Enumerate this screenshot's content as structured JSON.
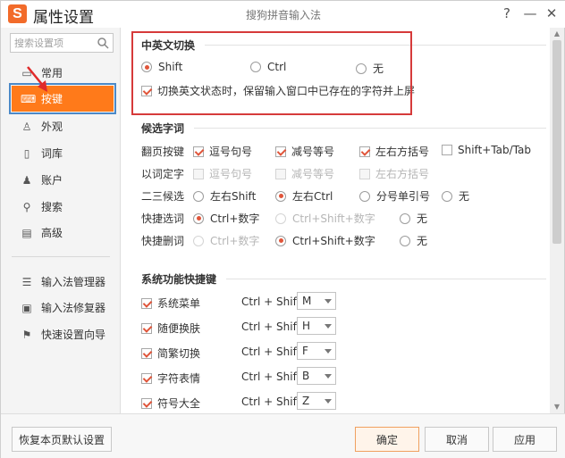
{
  "window": {
    "title": "属性设置",
    "app_name": "搜狗拼音输入法",
    "logo_letter": "S",
    "help": "?",
    "minimize": "—",
    "close": "✕"
  },
  "sidebar": {
    "search_placeholder": "搜索设置项",
    "items": [
      {
        "label": "常用",
        "icon": "gear-icon"
      },
      {
        "label": "按键",
        "icon": "keyboard-icon"
      },
      {
        "label": "外观",
        "icon": "shirt-icon"
      },
      {
        "label": "词库",
        "icon": "book-icon"
      },
      {
        "label": "账户",
        "icon": "user-icon"
      },
      {
        "label": "搜索",
        "icon": "search-icon"
      },
      {
        "label": "高级",
        "icon": "advanced-icon"
      }
    ],
    "tools": [
      {
        "label": "输入法管理器",
        "icon": "manager-icon"
      },
      {
        "label": "输入法修复器",
        "icon": "repair-icon"
      },
      {
        "label": "快速设置向导",
        "icon": "flag-icon"
      }
    ],
    "active_index": 1
  },
  "cn_en_switch": {
    "title": "中英文切换",
    "options": [
      "Shift",
      "Ctrl",
      "无"
    ],
    "selected": "Shift",
    "checkbox_label": "切换英文状态时，保留输入窗口中已存在的字符并上屏"
  },
  "candidates": {
    "title": "候选字词",
    "page_label": "翻页按键",
    "page_options": [
      {
        "label": "逗号句号",
        "checked": true
      },
      {
        "label": "减号等号",
        "checked": true
      },
      {
        "label": "左右方括号",
        "checked": true
      },
      {
        "label": "Shift+Tab/Tab",
        "checked": false
      }
    ],
    "word_label": "以词定字",
    "word_options": [
      "逗号句号",
      "减号等号",
      "左右方括号"
    ],
    "second_third_label": "二三候选",
    "second_third_options": [
      "左右Shift",
      "左右Ctrl",
      "分号单引号",
      "无"
    ],
    "second_third_selected": "左右Ctrl",
    "quick_select_label": "快捷选词",
    "quick_select_options": [
      "Ctrl+数字",
      "Ctrl+Shift+数字",
      "无"
    ],
    "quick_select_selected": "Ctrl+数字",
    "quick_delete_label": "快捷删词",
    "quick_delete_options": [
      "Ctrl+数字",
      "Ctrl+Shift+数字",
      "无"
    ],
    "quick_delete_selected": "Ctrl+Shift+数字"
  },
  "shortcuts": {
    "title": "系统功能快捷键",
    "prefix": "Ctrl + Shift +",
    "items": [
      {
        "label": "系统菜单",
        "key": "M"
      },
      {
        "label": "随便换肤",
        "key": "H"
      },
      {
        "label": "简繁切换",
        "key": "F"
      },
      {
        "label": "字符表情",
        "key": "B"
      },
      {
        "label": "符号大全",
        "key": "Z"
      }
    ]
  },
  "footer": {
    "restore": "恢复本页默认设置",
    "ok": "确定",
    "cancel": "取消",
    "apply": "应用"
  },
  "colors": {
    "accent": "#ff7a1a",
    "highlight_border": "#d63a3a",
    "check": "#e0553a"
  }
}
